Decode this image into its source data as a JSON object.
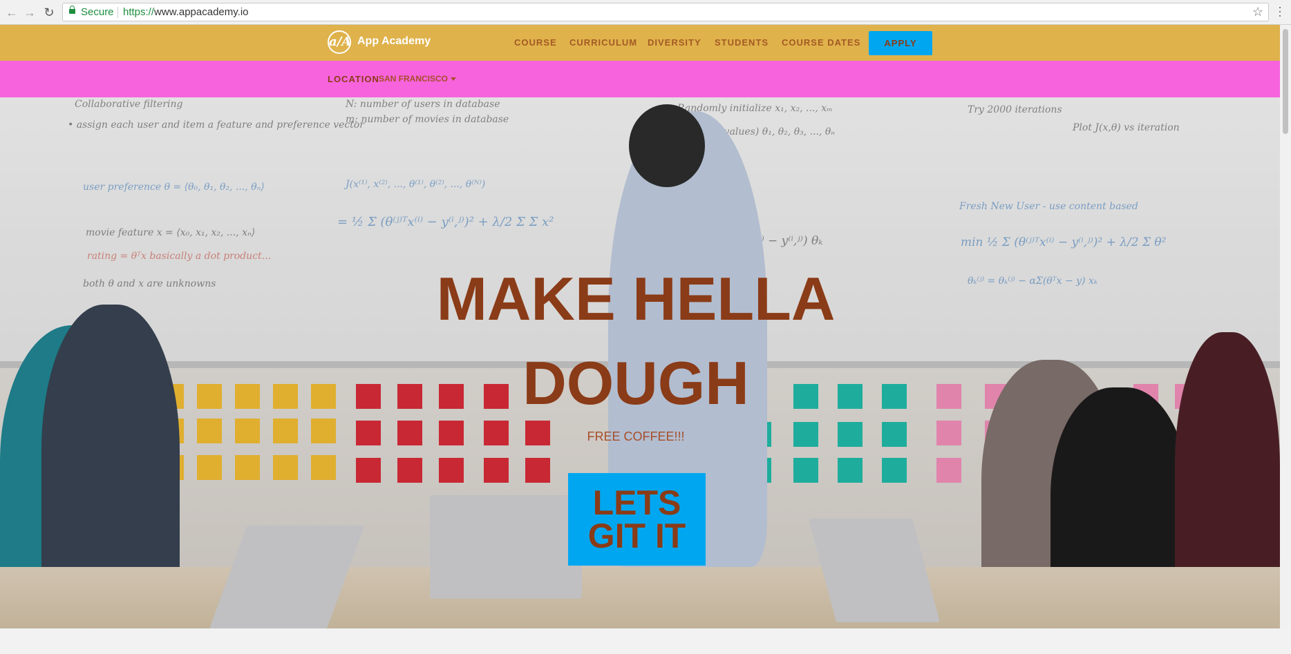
{
  "browser": {
    "secure_label": "Secure",
    "url_protocol": "https://",
    "url_rest": "www.appacademy.io"
  },
  "header": {
    "logo_mark": "a/A",
    "logo_text": "App Academy",
    "nav": [
      "COURSE",
      "CURRICULUM",
      "DIVERSITY",
      "STUDENTS",
      "COURSE DATES"
    ],
    "apply_label": "APPLY"
  },
  "location": {
    "label": "LOCATION",
    "value": "SAN FRANCISCO"
  },
  "hero": {
    "headline_line1": "MAKE HELLA",
    "headline_line2": "DOUGH",
    "subtext": "FREE COFFEE!!!",
    "cta_line1": "LETS",
    "cta_line2": "GIT IT"
  },
  "colors": {
    "header_bg": "#dfb24b",
    "location_bg": "#f763dd",
    "accent_blue": "#00a7f0",
    "text_brown": "#8a3b17"
  },
  "icons": [
    "back-icon",
    "forward-icon",
    "reload-icon",
    "lock-icon",
    "star-icon",
    "menu-icon",
    "caret-down-icon"
  ]
}
